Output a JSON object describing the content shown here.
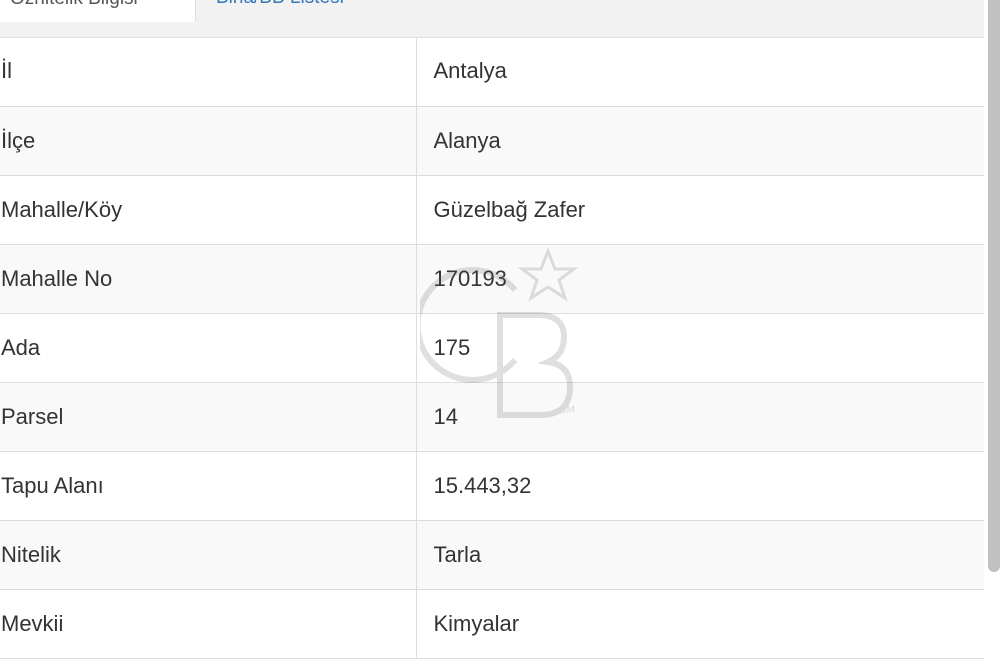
{
  "tabs": [
    {
      "label": "Öznitelik Bilgisi",
      "active": true
    },
    {
      "label": "Bina/BB Listesi",
      "active": false
    }
  ],
  "rows": [
    {
      "key": "İl",
      "value": "Antalya"
    },
    {
      "key": "İlçe",
      "value": "Alanya"
    },
    {
      "key": "Mahalle/Köy",
      "value": "Güzelbağ Zafer"
    },
    {
      "key": "Mahalle No",
      "value": "170193"
    },
    {
      "key": "Ada",
      "value": "175"
    },
    {
      "key": "Parsel",
      "value": "14"
    },
    {
      "key": "Tapu Alanı",
      "value": "15.443,32"
    },
    {
      "key": "Nitelik",
      "value": "Tarla"
    },
    {
      "key": "Mevkii",
      "value": "Kimyalar"
    }
  ],
  "watermark": {
    "text": "CB",
    "mark": "SM"
  },
  "colors": {
    "link": "#337ab7",
    "stripe": "#f9f9f9",
    "border": "#dddddd"
  }
}
